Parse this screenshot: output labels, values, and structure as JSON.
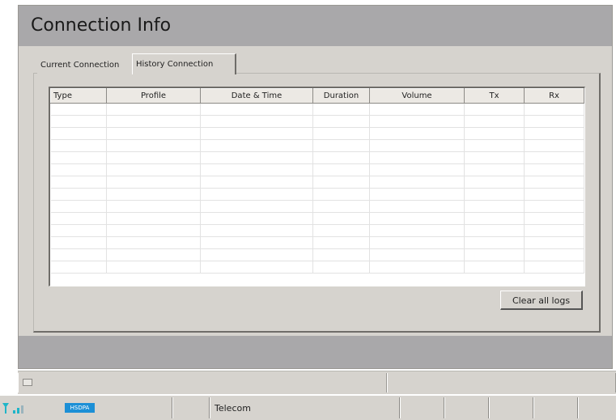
{
  "window": {
    "title": "Connection Info"
  },
  "tabs": [
    {
      "label": "Current Connection",
      "active": false
    },
    {
      "label": "History Connection",
      "active": true
    }
  ],
  "table": {
    "columns": [
      "Type",
      "Profile",
      "Date & Time",
      "Duration",
      "Volume",
      "Tx",
      "Rx"
    ],
    "empty_rows": 14
  },
  "buttons": {
    "clear": "Clear all logs"
  },
  "status": {
    "network_type": "HSDPA",
    "operator": "Telecom",
    "accent_color": "#1c8fd6"
  }
}
